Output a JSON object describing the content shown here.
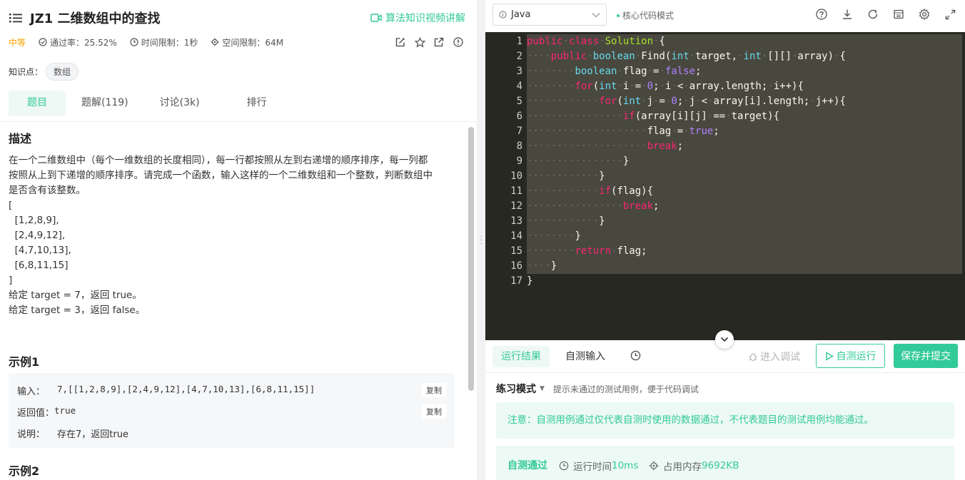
{
  "problem": {
    "title": "JZ1  二维数组中的查找",
    "video_link": "算法知识视频讲解",
    "difficulty": "中等",
    "pass_rate": "通过率：25.52%",
    "time_limit": "时间限制：1秒",
    "space_limit": "空间限制：64M",
    "knowledge_label": "知识点：",
    "knowledge_tag": "数组"
  },
  "tabs": [
    "题目",
    "题解(119)",
    "讨论(3k)",
    "排行"
  ],
  "description": {
    "heading": "描述",
    "lines": [
      "在一个二维数组中（每个一维数组的长度相同），每一行都按照从左到右递增的顺序排序，每一列都",
      "按照从上到下递增的顺序排序。请完成一个函数，输入这样的一个二维数组和一个整数，判断数组中",
      "是否含有该整数。",
      "[",
      "  [1,2,8,9],",
      "  [2,4,9,12],",
      "  [4,7,10,13],",
      "  [6,8,11,15]",
      "]",
      "给定 target = 7，返回 true。",
      "给定 target = 3，返回 false。"
    ]
  },
  "example1": {
    "title": "示例1",
    "input_label": "输入：",
    "input_value": "7,[[1,2,8,9],[2,4,9,12],[4,7,10,13],[6,8,11,15]]",
    "output_label": "返回值：",
    "output_value": "true",
    "explain_label": "说明：",
    "explain_value": "存在7，返回true",
    "copy": "复制"
  },
  "example2_title": "示例2",
  "editor": {
    "language": "Java",
    "mode": "核心代码模式",
    "line_numbers": [
      "1",
      "2",
      "3",
      "4",
      "5",
      "6",
      "7",
      "8",
      "9",
      "10",
      "11",
      "12",
      "13",
      "14",
      "15",
      "16",
      "17"
    ],
    "code": [
      [
        [
          "kw",
          "public"
        ],
        [
          "",
          "·"
        ],
        [
          "kw",
          "class"
        ],
        [
          "",
          "·"
        ],
        [
          "cls",
          "Solution"
        ],
        [
          "",
          "·{"
        ]
      ],
      [
        [
          "d",
          "····"
        ],
        [
          "kw",
          "public"
        ],
        [
          "",
          "·"
        ],
        [
          "ty",
          "boolean"
        ],
        [
          "",
          "·Find("
        ],
        [
          "ty",
          "int"
        ],
        [
          "",
          "·target,·"
        ],
        [
          "ty",
          "int"
        ],
        [
          "",
          "·[][]·array)·{"
        ]
      ],
      [
        [
          "d",
          "········"
        ],
        [
          "ty",
          "boolean"
        ],
        [
          "",
          "·flag·=·"
        ],
        [
          "lit",
          "false"
        ],
        [
          "",
          ";"
        ]
      ],
      [
        [
          "d",
          "········"
        ],
        [
          "kw",
          "for"
        ],
        [
          "",
          "("
        ],
        [
          "ty",
          "int"
        ],
        [
          "",
          "·i·=·"
        ],
        [
          "num",
          "0"
        ],
        [
          "",
          ";·i·<·array.length;·i++){"
        ]
      ],
      [
        [
          "d",
          "············"
        ],
        [
          "kw",
          "for"
        ],
        [
          "",
          "("
        ],
        [
          "ty",
          "int"
        ],
        [
          "",
          "·j·=·"
        ],
        [
          "num",
          "0"
        ],
        [
          "",
          ";·j·<·array[i].length;·j++){"
        ]
      ],
      [
        [
          "d",
          "················"
        ],
        [
          "kw",
          "if"
        ],
        [
          "",
          "(array[i][j]·==·target){"
        ]
      ],
      [
        [
          "d",
          "····················"
        ],
        [
          "",
          "flag·=·"
        ],
        [
          "lit",
          "true"
        ],
        [
          "",
          ";"
        ]
      ],
      [
        [
          "d",
          "····················"
        ],
        [
          "kw",
          "break"
        ],
        [
          "",
          ";"
        ]
      ],
      [
        [
          "d",
          "················"
        ],
        [
          "",
          "}"
        ]
      ],
      [
        [
          "d",
          "············"
        ],
        [
          "",
          "}"
        ]
      ],
      [
        [
          "d",
          "············"
        ],
        [
          "kw",
          "if"
        ],
        [
          "",
          "(flag){"
        ]
      ],
      [
        [
          "d",
          "················"
        ],
        [
          "kw",
          "break"
        ],
        [
          "",
          ";"
        ]
      ],
      [
        [
          "d",
          "············"
        ],
        [
          "",
          "}"
        ]
      ],
      [
        [
          "d",
          "········"
        ],
        [
          "",
          "}"
        ]
      ],
      [
        [
          "d",
          "········"
        ],
        [
          "kw",
          "return"
        ],
        [
          "",
          "·flag;"
        ]
      ],
      [
        [
          "d",
          "····"
        ],
        [
          "",
          "}"
        ]
      ],
      [
        [
          "",
          "}"
        ]
      ]
    ]
  },
  "result": {
    "tab_result": "运行结果",
    "tab_custom_input": "自测输入",
    "debug": "进入调试",
    "run": "自测运行",
    "submit": "保存并提交",
    "practice_mode": "练习模式",
    "practice_hint": "提示未通过的测试用例，便于代码调试",
    "notice": "注意：自测用例通过仅代表自测时使用的数据通过，不代表题目的测试用例均能通过。",
    "pass": "自测通过",
    "run_time_label": "运行时间",
    "run_time_value": "10ms",
    "memory_label": "占用内存",
    "memory_value": "9692KB"
  },
  "colors": {
    "accent": "#32ca99",
    "difficulty_medium": "#f8a000",
    "editor_bg": "#272822"
  }
}
